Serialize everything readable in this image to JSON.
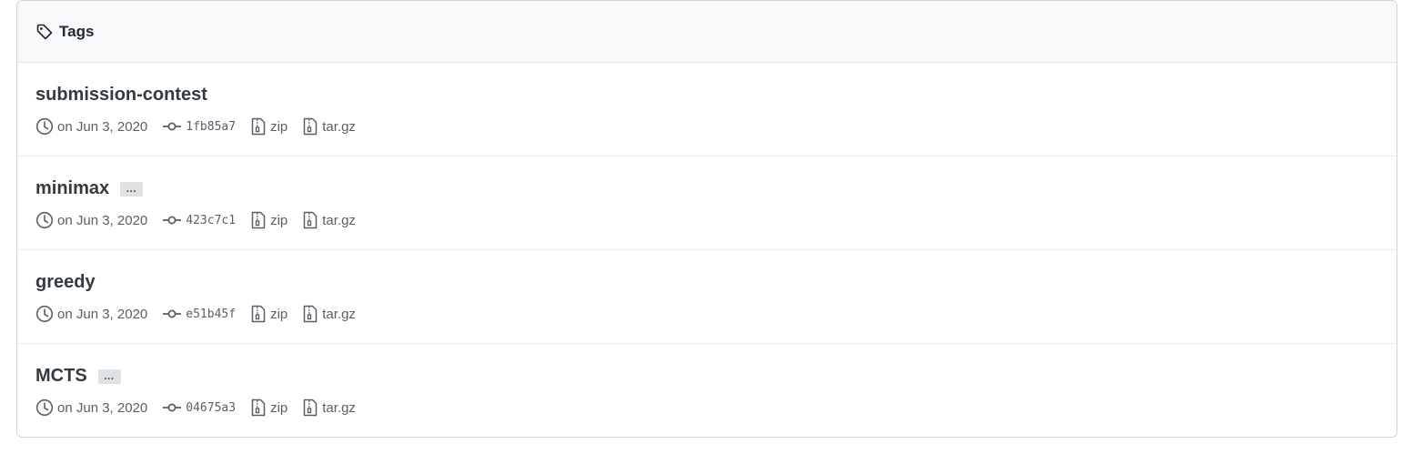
{
  "header": {
    "title": "Tags",
    "icon": "tag-icon"
  },
  "tags": [
    {
      "name": "submission-contest",
      "date": "on Jun 3, 2020",
      "commit": "1fb85a7",
      "zip": "zip",
      "targz": "tar.gz",
      "has_ellipsis": false,
      "ellipsis": "…"
    },
    {
      "name": "minimax",
      "date": "on Jun 3, 2020",
      "commit": "423c7c1",
      "zip": "zip",
      "targz": "tar.gz",
      "has_ellipsis": true,
      "ellipsis": "…"
    },
    {
      "name": "greedy",
      "date": "on Jun 3, 2020",
      "commit": "e51b45f",
      "zip": "zip",
      "targz": "tar.gz",
      "has_ellipsis": false,
      "ellipsis": "…"
    },
    {
      "name": "MCTS",
      "date": "on Jun 3, 2020",
      "commit": "04675a3",
      "zip": "zip",
      "targz": "tar.gz",
      "has_ellipsis": true,
      "ellipsis": "…"
    }
  ],
  "icons": {
    "date": "clock-icon",
    "commit": "git-commit-icon",
    "archive": "file-zip-icon"
  },
  "colors": {
    "header_bg": "#f6f8fa",
    "border": "#d1d5da",
    "muted_text": "#586069"
  }
}
